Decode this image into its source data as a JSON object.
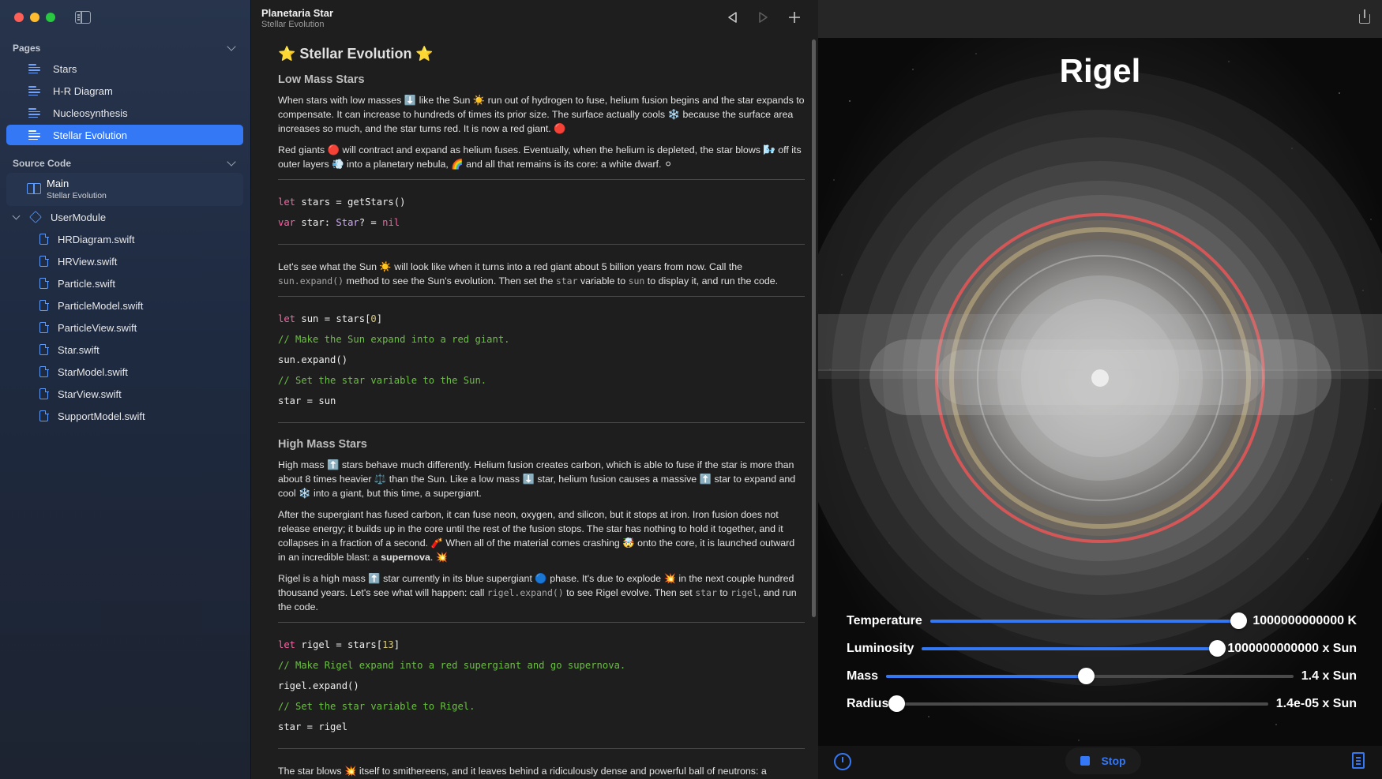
{
  "sidebar": {
    "pages_header": "Pages",
    "pages": [
      {
        "label": "Stars"
      },
      {
        "label": "H-R Diagram"
      },
      {
        "label": "Nucleosynthesis"
      },
      {
        "label": "Stellar Evolution",
        "selected": true
      }
    ],
    "source_header": "Source Code",
    "main": {
      "title": "Main",
      "subtitle": "Stellar Evolution"
    },
    "module": "UserModule",
    "files": [
      "HRDiagram.swift",
      "HRView.swift",
      "Particle.swift",
      "ParticleModel.swift",
      "ParticleView.swift",
      "Star.swift",
      "StarModel.swift",
      "StarView.swift",
      "SupportModel.swift"
    ]
  },
  "editor": {
    "title": "Planetaria Star",
    "subtitle": "Stellar Evolution",
    "heading": "⭐ Stellar Evolution ⭐",
    "low_mass_heading": "Low Mass Stars",
    "p1": "When stars with low masses ⬇️ like the Sun ☀️ run out of hydrogen to fuse, helium fusion begins and the star expands to compensate. It can increase to hundreds of times its prior size. The surface actually cools ❄️ because the surface area increases so much, and the star turns red. It is now a red giant. 🔴",
    "p2": "Red giants 🔴 will contract and expand as helium fuses. Eventually, when the helium is depleted, the star blows 🌬️ off its outer layers 💨 into a planetary nebula, 🌈 and all that remains is its core: a white dwarf. ⚪",
    "code1": {
      "l1_kw": "let",
      "l1_rest": " stars = getStars()",
      "l2_kw": "var",
      "l2_mid": " star: ",
      "l2_type": "Star",
      "l2_q": "? = ",
      "l2_nil": "nil"
    },
    "p3_a": "Let's see what the Sun ☀️ will look like when it turns into a red giant about 5 billion years from now. Call the ",
    "p3_code1": "sun.expand()",
    "p3_b": " method to see the Sun's evolution. Then set the ",
    "p3_code2": "star",
    "p3_c": " variable to ",
    "p3_code3": "sun",
    "p3_d": " to display it, and run the code.",
    "code2": {
      "l1_kw": "let",
      "l1_a": " sun = stars[",
      "l1_num": "0",
      "l1_b": "]",
      "c1": "// Make the Sun expand into a red giant.",
      "l3": "sun.expand()",
      "c2": "// Set the star variable to the Sun.",
      "l5": "star = sun"
    },
    "high_mass_heading": "High Mass Stars",
    "p4": "High mass ⬆️ stars behave much differently. Helium fusion creates carbon, which is able to fuse if the star is more than about 8 times heavier ⚖️ than the Sun. Like a low mass ⬇️ star, helium fusion causes a massive ⬆️ star to expand and cool ❄️ into a giant, but this time, a supergiant.",
    "p5_a": "After the supergiant has fused carbon, it can fuse neon, oxygen, and silicon, but it stops at iron. Iron fusion does not release energy; it builds up in the core until the rest of the fusion stops. The star has nothing to hold it together, and it collapses in a fraction of a second. 🧨 When all of the material comes crashing 🤯 onto the core, it is launched outward in an incredible blast: a ",
    "p5_bold": "supernova",
    "p5_b": ". 💥",
    "p6_a": "Rigel is a high mass ⬆️ star currently in its blue supergiant 🔵 phase. It's due to explode 💥 in the next couple hundred thousand years. Let's see what will happen: call ",
    "p6_code1": "rigel.expand()",
    "p6_b": " to see Rigel evolve. Then set ",
    "p6_code2": "star",
    "p6_c": " to ",
    "p6_code3": "rigel",
    "p6_d": ", and run the code.",
    "code3": {
      "l1_kw": "let",
      "l1_a": " rigel = stars[",
      "l1_num": "13",
      "l1_b": "]",
      "c1": "// Make Rigel expand into a red supergiant and go supernova.",
      "l3": "rigel.expand()",
      "c2": "// Set the star variable to Rigel.",
      "l5": "star = rigel"
    },
    "p7": "The star blows 💥 itself to smithereens, and it leaves behind a ridiculously dense and powerful ball of neutrons: a"
  },
  "live": {
    "star_name": "Rigel",
    "sliders": [
      {
        "label": "Temperature",
        "value": "1000000000000 K",
        "fraction": 0.98
      },
      {
        "label": "Luminosity",
        "value": "1000000000000 x Sun",
        "fraction": 0.99
      },
      {
        "label": "Mass",
        "value": "1.4 x Sun",
        "fraction": 0.49
      },
      {
        "label": "Radius",
        "value": "1.4e-05 x Sun",
        "fraction": 0.0
      }
    ],
    "stop_label": "Stop"
  },
  "colors": {
    "accent": "#3478f6",
    "keyword": "#fc5fa3",
    "comment": "#6cbf43",
    "number": "#d9c97c",
    "ring_red": "#e05656"
  }
}
